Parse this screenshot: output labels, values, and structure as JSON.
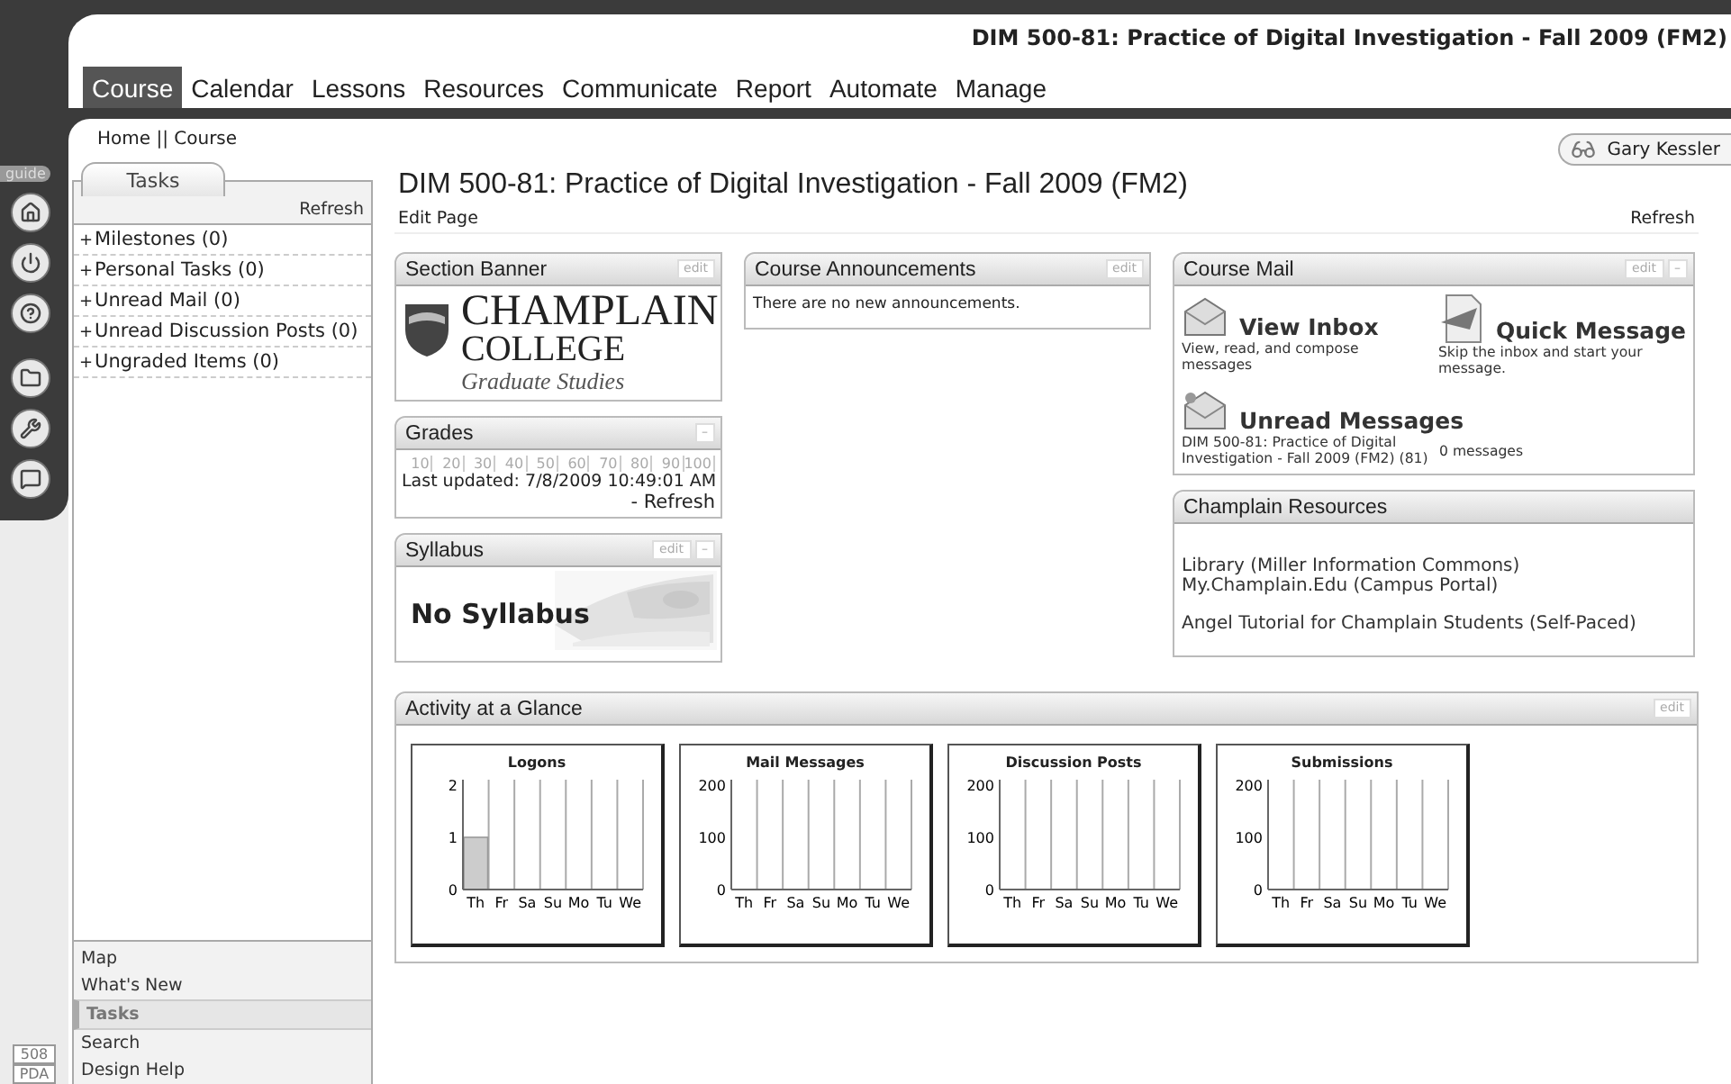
{
  "header": {
    "course_title": "DIM 500-81: Practice of Digital Investigation - Fall 2009 (FM2)"
  },
  "tabs": [
    {
      "label": "Course",
      "selected": true
    },
    {
      "label": "Calendar",
      "selected": false
    },
    {
      "label": "Lessons",
      "selected": false
    },
    {
      "label": "Resources",
      "selected": false
    },
    {
      "label": "Communicate",
      "selected": false
    },
    {
      "label": "Report",
      "selected": false
    },
    {
      "label": "Automate",
      "selected": false
    },
    {
      "label": "Manage",
      "selected": false
    }
  ],
  "breadcrumb": "Home || Course",
  "user": {
    "name": "Gary Kessler"
  },
  "guide_tab": "guide",
  "side_badges": [
    "508",
    "PDA"
  ],
  "tasks_panel": {
    "tab": "Tasks",
    "refresh": "Refresh",
    "items": [
      {
        "marker": "+",
        "label": "Milestones (0)"
      },
      {
        "marker": "+",
        "label": "Personal Tasks (0)"
      },
      {
        "marker": "+",
        "label": "Unread Mail (0)"
      },
      {
        "marker": "+",
        "label": "Unread Discussion Posts (0)"
      },
      {
        "marker": "+",
        "label": "Ungraded Items (0)"
      }
    ]
  },
  "nav": [
    {
      "label": "Map",
      "selected": false
    },
    {
      "label": "What's New",
      "selected": false
    },
    {
      "label": "Tasks",
      "selected": true
    },
    {
      "label": "Search",
      "selected": false
    },
    {
      "label": "Design Help",
      "selected": false
    }
  ],
  "page": {
    "title": "DIM 500-81: Practice of Digital Investigation - Fall 2009 (FM2)",
    "edit_link": "Edit Page",
    "refresh": "Refresh"
  },
  "section_banner": {
    "title": "Section Banner",
    "edit": "edit",
    "logo": {
      "name": "CHAMPLAIN",
      "sub": "COLLEGE",
      "tagline": "Graduate Studies"
    }
  },
  "grades": {
    "title": "Grades",
    "collapse": "–",
    "scale": [
      "10",
      "20",
      "30",
      "40",
      "50",
      "60",
      "70",
      "80",
      "90",
      "100"
    ],
    "updated": "Last updated: 7/8/2009 10:49:01 AM",
    "refresh": "- Refresh"
  },
  "syllabus": {
    "title": "Syllabus",
    "edit": "edit",
    "collapse": "–",
    "text": "No Syllabus"
  },
  "announcements": {
    "title": "Course Announcements",
    "edit": "edit",
    "text": "There are no new announcements."
  },
  "course_mail": {
    "title": "Course Mail",
    "edit": "edit",
    "collapse": "–",
    "actions": [
      {
        "kind": "inbox",
        "title": "View Inbox",
        "description": "View, read, and compose messages"
      },
      {
        "kind": "quick",
        "title": "Quick Message",
        "description": "Skip the inbox and start your message."
      }
    ],
    "unread": {
      "title": "Unread Messages",
      "course": "DIM 500-81: Practice of Digital Investigation - Fall 2009 (FM2) (81)",
      "count": "0 messages"
    }
  },
  "resources": {
    "title": "Champlain Resources",
    "groups": [
      [
        "Library (Miller Information Commons)",
        "My.Champlain.Edu (Campus Portal)"
      ],
      [
        "Angel Tutorial for Champlain Students (Self-Paced)"
      ]
    ]
  },
  "activity": {
    "title": "Activity at a Glance",
    "edit": "edit",
    "charts": [
      {
        "chart_data": {
          "type": "bar",
          "title": "Logons",
          "categories": [
            "Th",
            "Fr",
            "Sa",
            "Su",
            "Mo",
            "Tu",
            "We"
          ],
          "values": [
            1,
            0,
            0,
            0,
            0,
            0,
            0
          ],
          "ylim": [
            0,
            2
          ],
          "yticks": [
            0,
            1,
            2
          ]
        }
      },
      {
        "chart_data": {
          "type": "bar",
          "title": "Mail Messages",
          "categories": [
            "Th",
            "Fr",
            "Sa",
            "Su",
            "Mo",
            "Tu",
            "We"
          ],
          "values": [
            0,
            0,
            0,
            0,
            0,
            0,
            0
          ],
          "ylim": [
            0,
            200
          ],
          "yticks": [
            0,
            100,
            200
          ]
        }
      },
      {
        "chart_data": {
          "type": "bar",
          "title": "Discussion Posts",
          "categories": [
            "Th",
            "Fr",
            "Sa",
            "Su",
            "Mo",
            "Tu",
            "We"
          ],
          "values": [
            0,
            0,
            0,
            0,
            0,
            0,
            0
          ],
          "ylim": [
            0,
            200
          ],
          "yticks": [
            0,
            100,
            200
          ]
        }
      },
      {
        "chart_data": {
          "type": "bar",
          "title": "Submissions",
          "categories": [
            "Th",
            "Fr",
            "Sa",
            "Su",
            "Mo",
            "Tu",
            "We"
          ],
          "values": [
            0,
            0,
            0,
            0,
            0,
            0,
            0
          ],
          "ylim": [
            0,
            200
          ],
          "yticks": [
            0,
            100,
            200
          ]
        }
      }
    ]
  }
}
